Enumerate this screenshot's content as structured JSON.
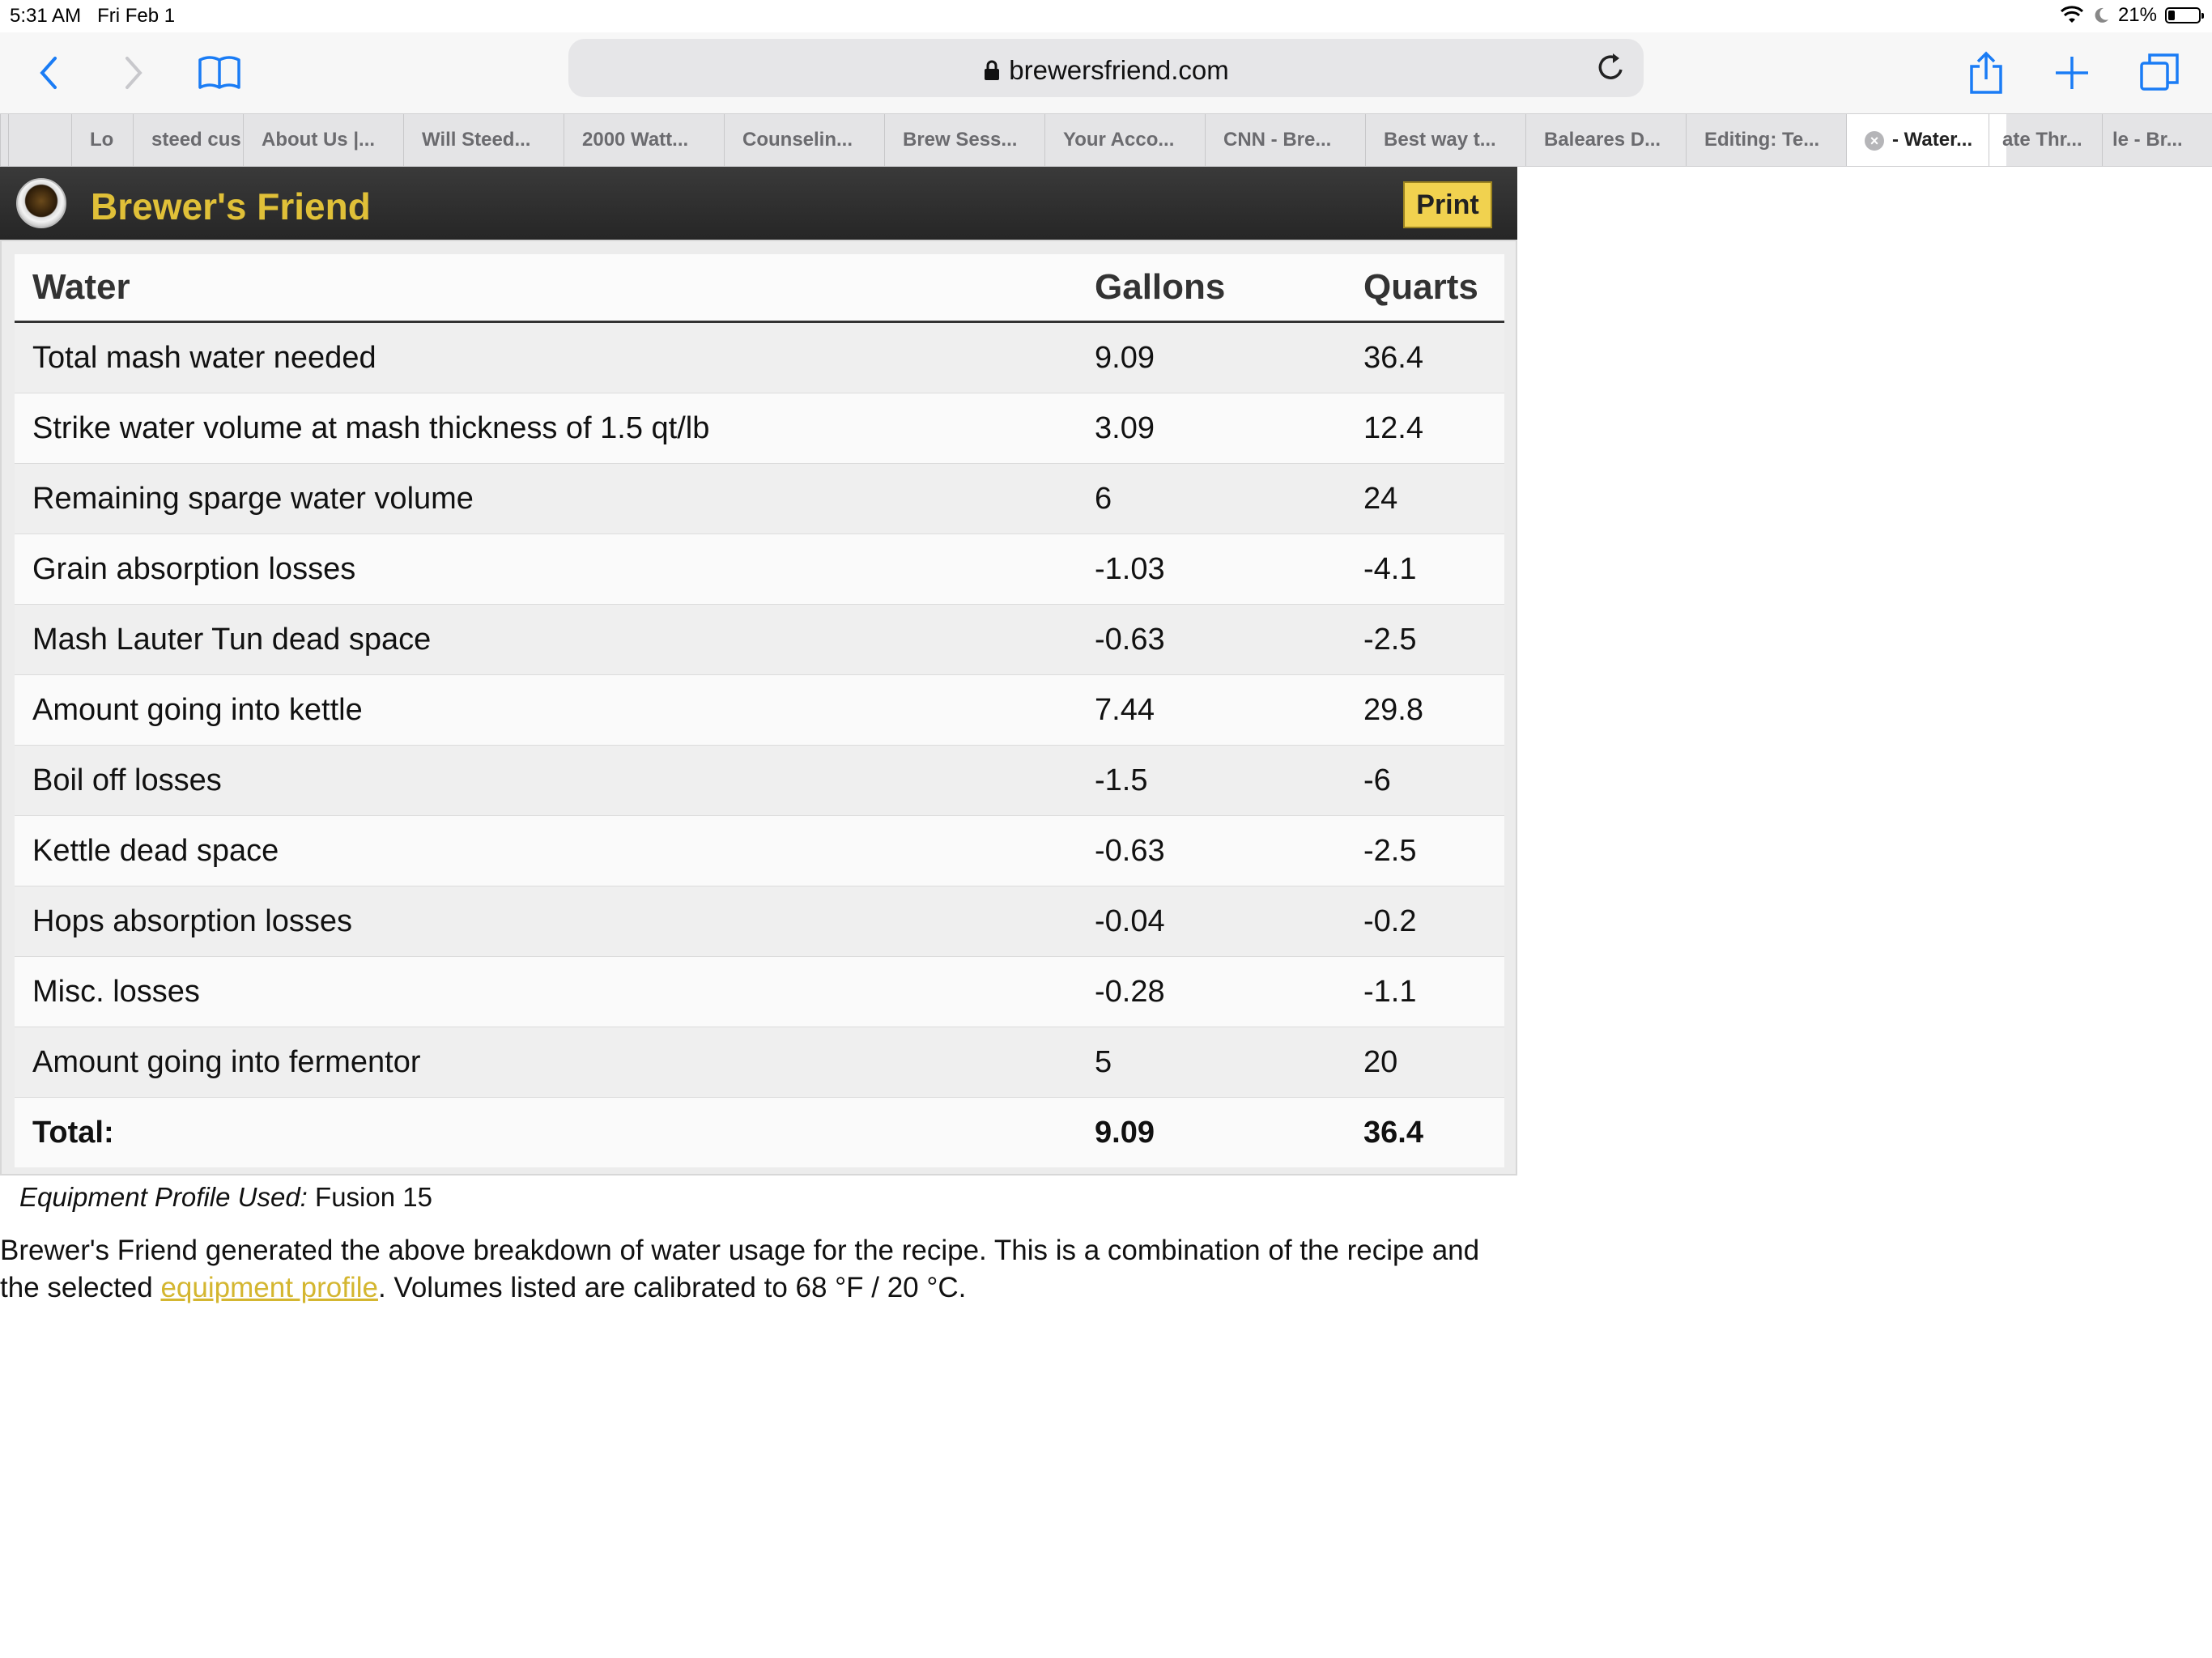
{
  "status_bar": {
    "time": "5:31 AM",
    "date": "Fri Feb 1",
    "battery": "21%",
    "battery_level": 0.21
  },
  "browser": {
    "url": "brewersfriend.com",
    "tabs": [
      {
        "label": "Lo"
      },
      {
        "label": "steed cus"
      },
      {
        "label": "About Us |..."
      },
      {
        "label": "Will Steed..."
      },
      {
        "label": "2000 Watt..."
      },
      {
        "label": "Counselin..."
      },
      {
        "label": "Brew Sess..."
      },
      {
        "label": "Your Acco..."
      },
      {
        "label": "CNN - Bre..."
      },
      {
        "label": "Best way t..."
      },
      {
        "label": "Baleares D..."
      },
      {
        "label": "Editing: Te..."
      },
      {
        "label": "- Water..."
      },
      {
        "label": "ate Thr..."
      },
      {
        "label": "le - Br..."
      }
    ],
    "active_tab_index": 12
  },
  "site": {
    "brand": "Brewer's Friend",
    "print_label": "Print",
    "accent": "#e0c038"
  },
  "table": {
    "headers": [
      "Water",
      "Gallons",
      "Quarts"
    ],
    "rows": [
      [
        "Total mash water needed",
        "9.09",
        "36.4"
      ],
      [
        "Strike water volume at mash thickness of 1.5 qt/lb",
        "3.09",
        "12.4"
      ],
      [
        "Remaining sparge water volume",
        "6",
        "24"
      ],
      [
        "Grain absorption losses",
        "-1.03",
        "-4.1"
      ],
      [
        "Mash Lauter Tun dead space",
        "-0.63",
        "-2.5"
      ],
      [
        "Amount going into kettle",
        "7.44",
        "29.8"
      ],
      [
        "Boil off losses",
        "-1.5",
        "-6"
      ],
      [
        "Kettle dead space",
        "-0.63",
        "-2.5"
      ],
      [
        "Hops absorption losses",
        "-0.04",
        "-0.2"
      ],
      [
        "Misc. losses",
        "-0.28",
        "-1.1"
      ],
      [
        "Amount going into fermentor",
        "5",
        "20"
      ]
    ],
    "total": [
      "Total:",
      "9.09",
      "36.4"
    ]
  },
  "equipment": {
    "label": "Equipment Profile Used:",
    "value": "Fusion 15"
  },
  "description": {
    "before": "Brewer's Friend generated the above breakdown of water usage for the recipe. This is a combination of the recipe and the selected ",
    "link": "equipment profile",
    "after": ". Volumes listed are calibrated to 68 °F / 20 °C."
  }
}
